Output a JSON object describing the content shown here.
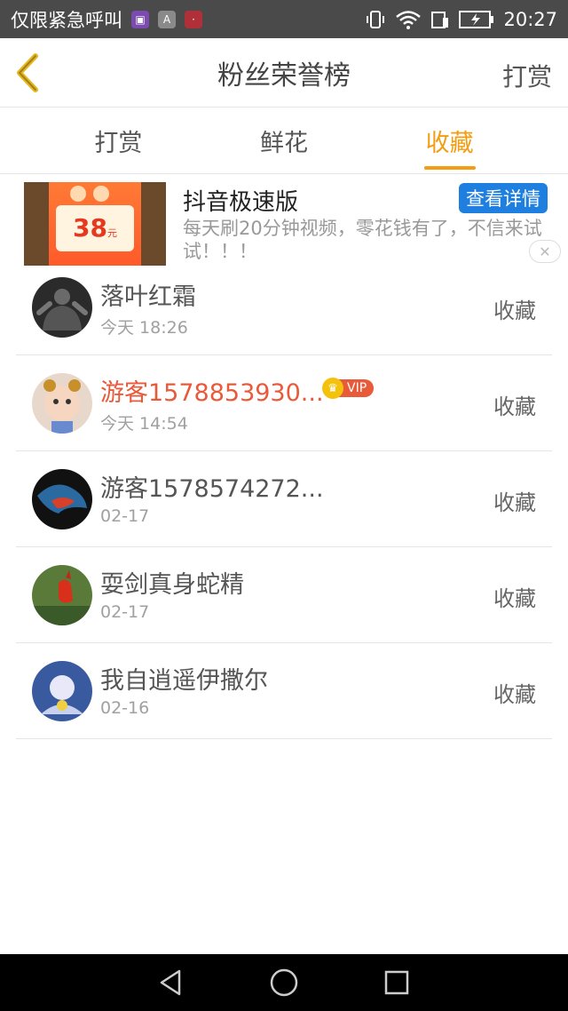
{
  "status_bar": {
    "carrier": "仅限紧急呼叫",
    "time": "20:27",
    "app_icons": [
      "gallery-icon",
      "a-icon",
      "red-app-icon"
    ]
  },
  "header": {
    "title": "粉丝荣誉榜",
    "action": "打赏"
  },
  "tabs": [
    {
      "label": "打赏",
      "active": false
    },
    {
      "label": "鲜花",
      "active": false
    },
    {
      "label": "收藏",
      "active": true
    }
  ],
  "ad": {
    "image_amount": "38",
    "image_unit": "元",
    "title": "抖音极速版",
    "button": "查看详情",
    "description": "每天刷20分钟视频，零花钱有了，不信来试试！！！"
  },
  "list": [
    {
      "name": "落叶红霜",
      "time": "今天 18:26",
      "action": "收藏",
      "vip": false,
      "avatar_color": "#2b2b2b"
    },
    {
      "name": "游客1578853930...",
      "time": "今天 14:54",
      "action": "收藏",
      "vip": true,
      "vip_label": "VIP",
      "avatar_color": "#d9b8a0"
    },
    {
      "name": "游客1578574272...",
      "time": "02-17",
      "action": "收藏",
      "vip": false,
      "avatar_color": "#1a2a3a"
    },
    {
      "name": "耍剑真身蛇精",
      "time": "02-17",
      "action": "收藏",
      "vip": false,
      "avatar_color": "#5a7a3a"
    },
    {
      "name": "我自逍遥伊撒尔",
      "time": "02-16",
      "action": "收藏",
      "vip": false,
      "avatar_color": "#3a5aa0"
    }
  ],
  "colors": {
    "accent": "#f29d12",
    "vip_name": "#e85a3a",
    "ad_button": "#1e7fe0"
  }
}
